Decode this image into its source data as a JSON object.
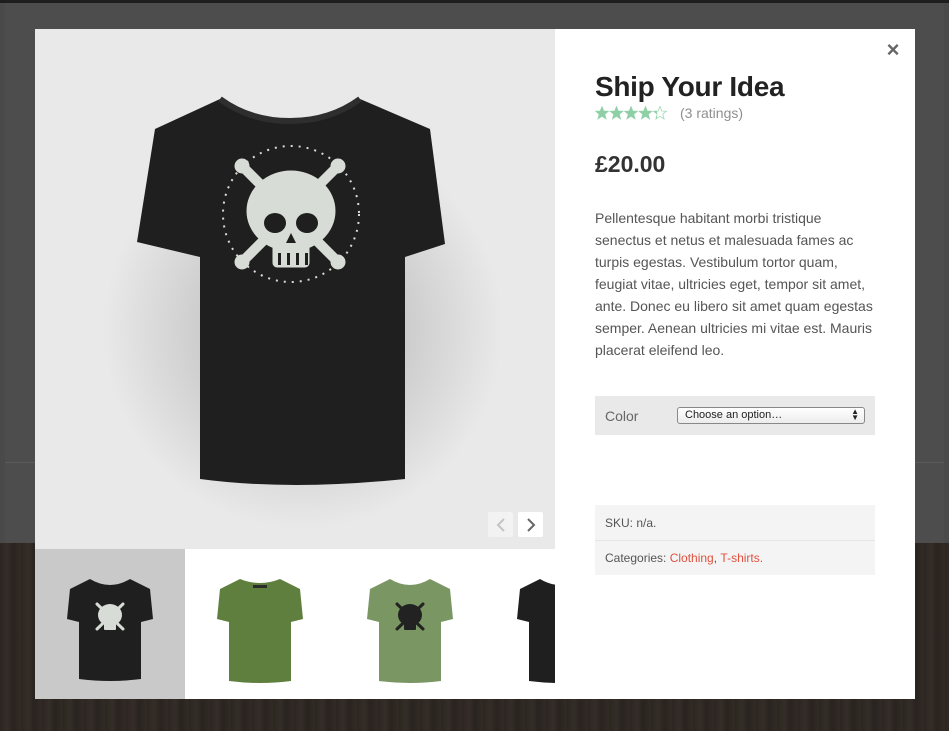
{
  "product": {
    "title": "Ship Your Idea",
    "rating": {
      "value": 4.33,
      "max": 5,
      "count_text": "(3 ratings)"
    },
    "price": "£20.00",
    "description": "Pellentesque habitant morbi tristique senectus et netus et malesuada fames ac turpis egestas. Vestibulum tortor quam, feugiat vitae, ultricies eget, tempor sit amet, ante. Donec eu libero sit amet quam egestas semper. Aenean ultricies mi vitae est. Mauris placerat eleifend leo.",
    "variation": {
      "label": "Color",
      "selected": "Choose an option…"
    },
    "meta": {
      "sku": "SKU: n/a.",
      "categories_prefix": "Categories: ",
      "categories": [
        "Clothing",
        "T-shirts"
      ],
      "separator": ", ",
      "end": "."
    }
  },
  "gallery": {
    "main_image": "t-shirt-black-skull-front",
    "thumbnails": [
      {
        "name": "black-skull-tshirt",
        "active": true
      },
      {
        "name": "green-tshirt-back",
        "active": false
      },
      {
        "name": "green-skull-tshirt",
        "active": false
      },
      {
        "name": "black-tshirt",
        "active": false
      }
    ]
  },
  "icons": {
    "close": "×",
    "prev": "prev-arrow-icon",
    "next": "next-arrow-icon",
    "star": "star-icon"
  },
  "colors": {
    "accent_link": "#e0523f",
    "star": "#8fcfa6",
    "shirt_black": "#1f1f1f",
    "shirt_green": "#5f7f3f",
    "shirt_green_light": "#7a9663"
  }
}
